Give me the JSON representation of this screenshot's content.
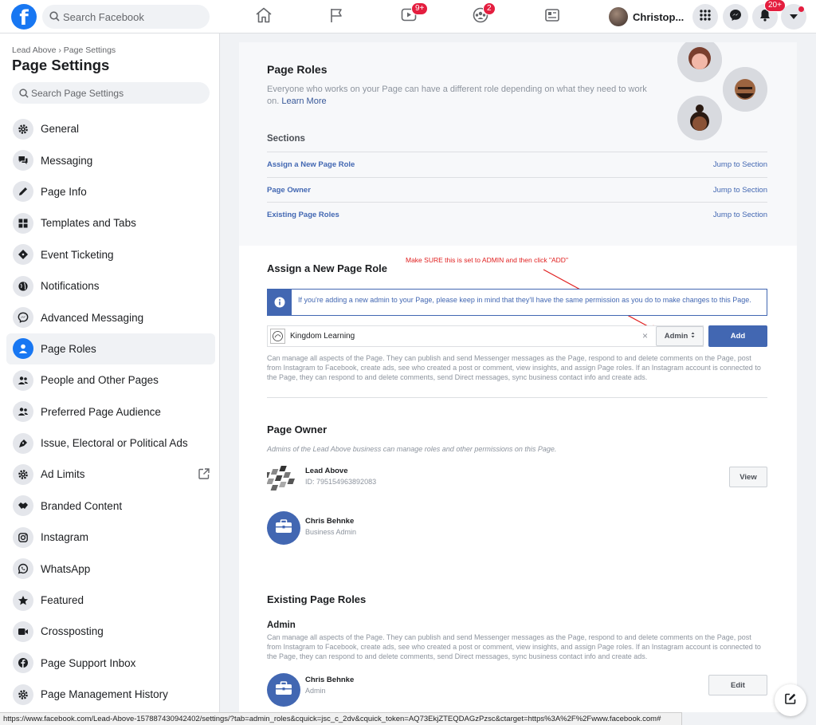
{
  "topbar": {
    "logo": "f",
    "search_placeholder": "Search Facebook",
    "watch_badge": "9+",
    "groups_badge": "2",
    "profile_name": "Christop...",
    "notifications_badge": "20+"
  },
  "sidebar": {
    "breadcrumb": "Lead Above › Page Settings",
    "title": "Page Settings",
    "search_placeholder": "Search Page Settings",
    "items": [
      {
        "label": "General",
        "icon": "gear-icon"
      },
      {
        "label": "Messaging",
        "icon": "chat-icon"
      },
      {
        "label": "Page Info",
        "icon": "pencil-icon"
      },
      {
        "label": "Templates and Tabs",
        "icon": "grid-icon"
      },
      {
        "label": "Event Ticketing",
        "icon": "ticket-icon"
      },
      {
        "label": "Notifications",
        "icon": "globe-icon"
      },
      {
        "label": "Advanced Messaging",
        "icon": "messenger-icon"
      },
      {
        "label": "Page Roles",
        "icon": "person-icon"
      },
      {
        "label": "People and Other Pages",
        "icon": "people-icon"
      },
      {
        "label": "Preferred Page Audience",
        "icon": "people-icon"
      },
      {
        "label": "Issue, Electoral or Political Ads",
        "icon": "pen-nib-icon"
      },
      {
        "label": "Ad Limits",
        "icon": "gear-icon"
      },
      {
        "label": "Branded Content",
        "icon": "handshake-icon"
      },
      {
        "label": "Instagram",
        "icon": "instagram-icon"
      },
      {
        "label": "WhatsApp",
        "icon": "whatsapp-icon"
      },
      {
        "label": "Featured",
        "icon": "star-icon"
      },
      {
        "label": "Crossposting",
        "icon": "video-icon"
      },
      {
        "label": "Page Support Inbox",
        "icon": "facebook-icon"
      },
      {
        "label": "Page Management History",
        "icon": "gear-icon"
      }
    ],
    "active_item": "Page Roles"
  },
  "main": {
    "page_roles": {
      "title": "Page Roles",
      "description": "Everyone who works on your Page can have a different role depending on what they need to work on.",
      "learn_more": "Learn More",
      "sections_label": "Sections",
      "sections": [
        {
          "label": "Assign a New Page Role",
          "jump": "Jump to Section"
        },
        {
          "label": "Page Owner",
          "jump": "Jump to Section"
        },
        {
          "label": "Existing Page Roles",
          "jump": "Jump to Section"
        }
      ]
    },
    "assign": {
      "title": "Assign a New Page Role",
      "annotation": "Make SURE this is set to ADMIN and then click \"ADD\"",
      "info_text": "If you're adding a new admin to your Page, please keep in mind that they'll have the same permission as you do to make changes to this Page.",
      "input_value": "Kingdom Learning",
      "role_select": "Admin",
      "add_button": "Add",
      "description": "Can manage all aspects of the Page. They can publish and send Messenger messages as the Page, respond to and delete comments on the Page, post from Instagram to Facebook, create ads, see who created a post or comment, view insights, and assign Page roles. If an Instagram account is connected to the Page, they can respond to and delete comments, send Direct messages, sync business contact info and create ads."
    },
    "owner": {
      "title": "Page Owner",
      "description": "Admins of the Lead Above business can manage roles and other permissions on this Page.",
      "business_name": "Lead Above",
      "business_id": "ID: 795154963892083",
      "view_button": "View",
      "admin_name": "Chris Behnke",
      "admin_role": "Business Admin"
    },
    "existing": {
      "title": "Existing Page Roles",
      "role_heading": "Admin",
      "description": "Can manage all aspects of the Page. They can publish and send Messenger messages as the Page, respond to and delete comments on the Page, post from Instagram to Facebook, create ads, see who created a post or comment, view insights, and assign Page roles. If an Instagram account is connected to the Page, they can respond to and delete comments, send Direct messages, sync business contact info and create ads.",
      "person_name": "Chris Behnke",
      "person_role": "Admin",
      "edit_button": "Edit"
    }
  },
  "status_bar": "https://www.facebook.com/Lead-Above-157887430942402/settings/?tab=admin_roles&cquick=jsc_c_2dv&cquick_token=AQ73EkjZTEQDAGzPzsc&ctarget=https%3A%2F%2Fwww.facebook.com#",
  "colors": {
    "brand": "#1877f2",
    "link": "#4267b2",
    "annotation": "#e02020"
  }
}
